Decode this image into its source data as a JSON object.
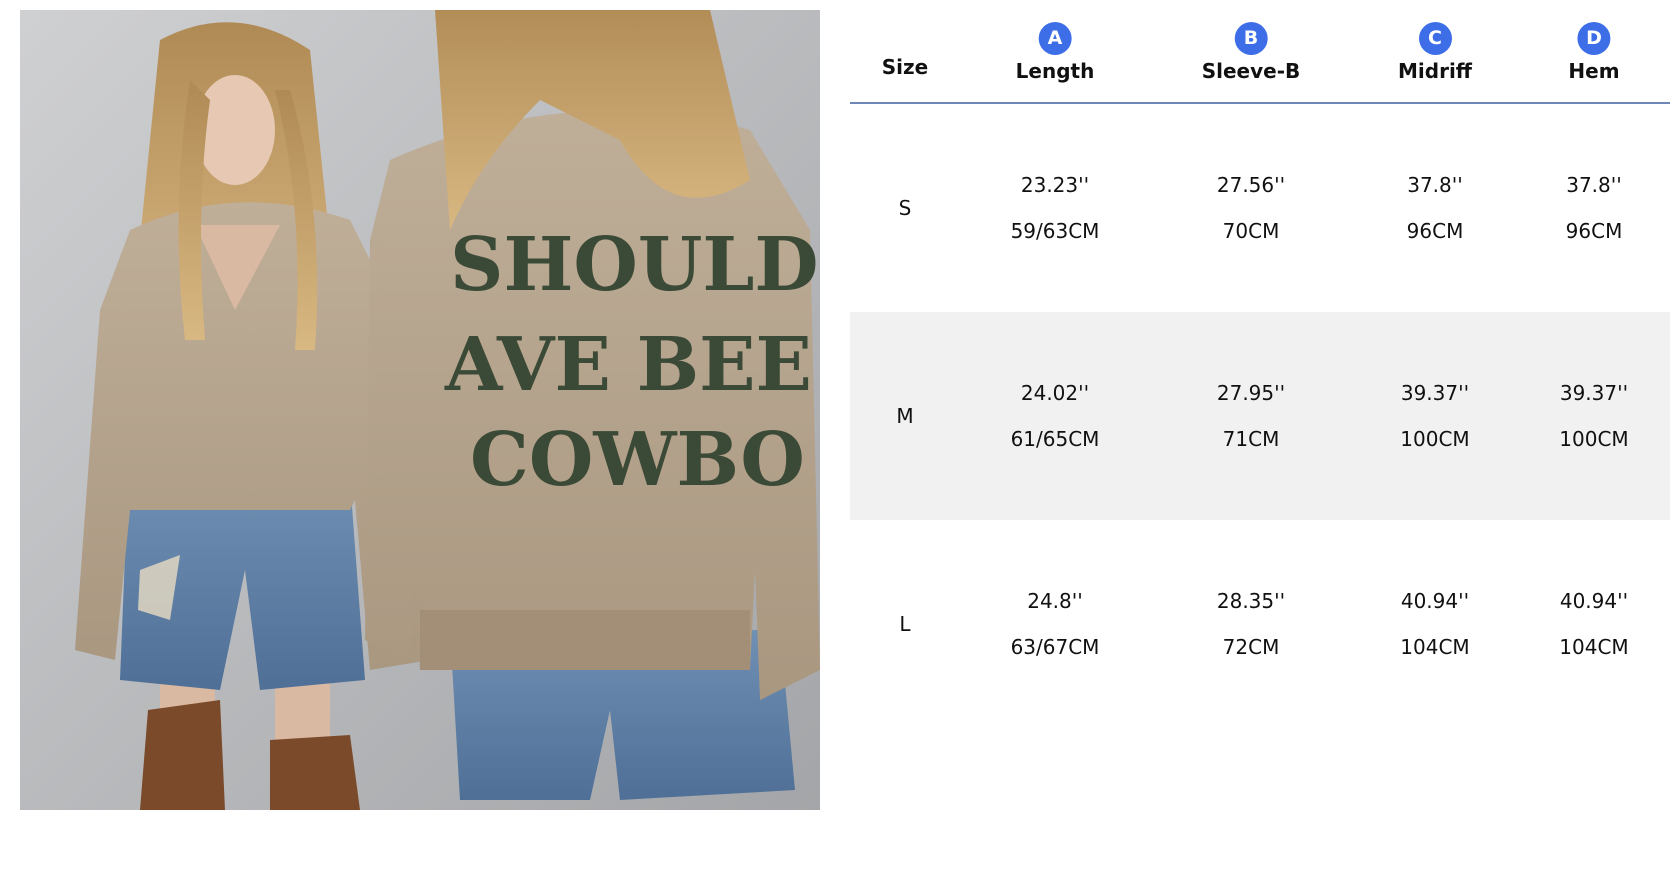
{
  "photo": {
    "alt_label": "product-photo",
    "knit_text": [
      "SHOULD",
      "AVE BEE",
      "COWBO"
    ]
  },
  "table": {
    "size_header": "Size",
    "columns": [
      {
        "badge": "A",
        "label": "Length"
      },
      {
        "badge": "B",
        "label": "Sleeve-B"
      },
      {
        "badge": "C",
        "label": "Midriff"
      },
      {
        "badge": "D",
        "label": "Hem"
      }
    ],
    "rows": [
      {
        "size": "S",
        "cells": [
          {
            "inch": "23.23''",
            "cm": "59/63CM"
          },
          {
            "inch": "27.56''",
            "cm": "70CM"
          },
          {
            "inch": "37.8''",
            "cm": "96CM"
          },
          {
            "inch": "37.8''",
            "cm": "96CM"
          }
        ]
      },
      {
        "size": "M",
        "cells": [
          {
            "inch": "24.02''",
            "cm": "61/65CM"
          },
          {
            "inch": "27.95''",
            "cm": "71CM"
          },
          {
            "inch": "39.37''",
            "cm": "100CM"
          },
          {
            "inch": "39.37''",
            "cm": "100CM"
          }
        ]
      },
      {
        "size": "L",
        "cells": [
          {
            "inch": "24.8''",
            "cm": "63/67CM"
          },
          {
            "inch": "28.35''",
            "cm": "72CM"
          },
          {
            "inch": "40.94''",
            "cm": "104CM"
          },
          {
            "inch": "40.94''",
            "cm": "104CM"
          }
        ]
      }
    ],
    "colors": {
      "badge": "#3d6ee8",
      "header_rule": "#6f87b8",
      "shaded_row": "#f1f1f1"
    }
  }
}
